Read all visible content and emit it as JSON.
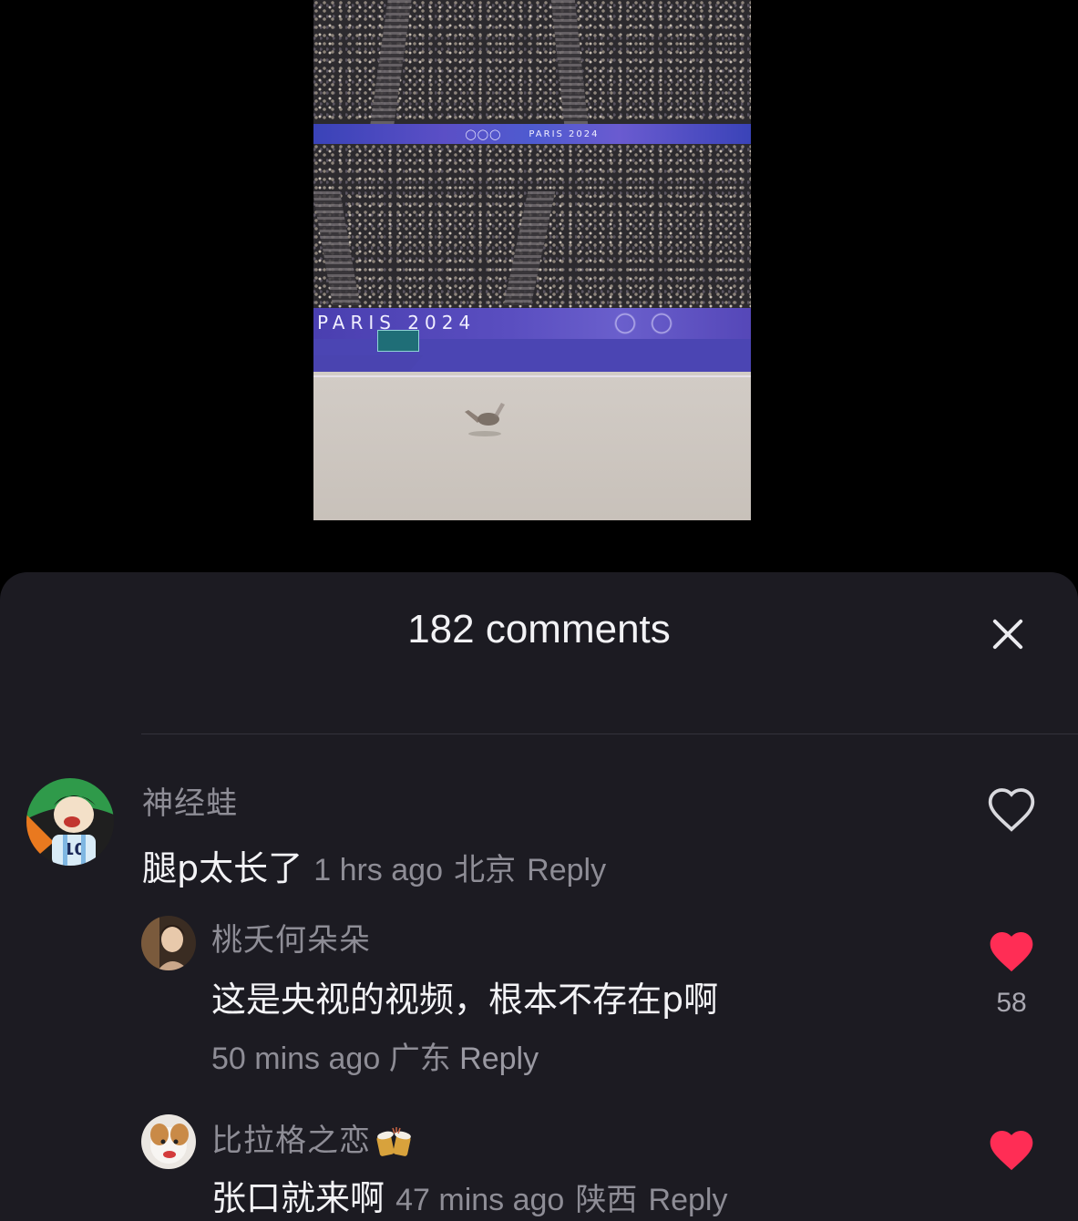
{
  "video": {
    "arena_banner_text": "PARIS 2024",
    "floor_banner_text": "PARIS 2024"
  },
  "comments_panel": {
    "title": "182 comments",
    "close_icon": "close-icon"
  },
  "comments": [
    {
      "username": "神经蛙",
      "text": "腿p太长了",
      "time": "1 hrs ago",
      "location": "北京",
      "reply_label": "Reply",
      "liked": false,
      "like_icon": "heart-outline-icon"
    }
  ],
  "replies": [
    {
      "username": "桃夭何朵朵",
      "text": "这是央视的视频，根本不存在p啊",
      "time": "50 mins ago",
      "location": "广东",
      "reply_label": "Reply",
      "liked": true,
      "like_count": "58",
      "like_icon": "heart-filled-icon"
    },
    {
      "username": "比拉格之恋",
      "username_emoji": "beer-mugs-emoji",
      "text": "张口就来啊",
      "time": "47 mins ago",
      "location": "陕西",
      "reply_label": "Reply",
      "liked": true,
      "like_icon": "heart-filled-icon"
    }
  ],
  "colors": {
    "panel_bg": "#1c1b22",
    "like_red": "#ff2d55",
    "muted_text": "#8e8d96"
  }
}
